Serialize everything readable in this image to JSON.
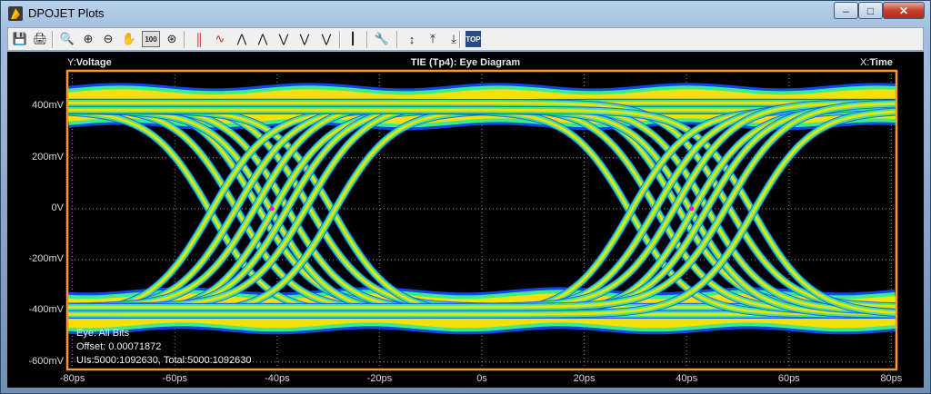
{
  "window": {
    "title": "DPOJET Plots"
  },
  "controls": {
    "minimize": "–",
    "maximize": "□",
    "close": "✕"
  },
  "toolbar": [
    {
      "name": "save-icon",
      "glyph": "💾"
    },
    {
      "name": "print-icon",
      "glyph": "🖨"
    },
    {
      "name": "zoom-in-icon",
      "glyph": "🔍"
    },
    {
      "name": "zoom-box-icon",
      "glyph": "⊕"
    },
    {
      "name": "zoom-out-icon",
      "glyph": "⊖"
    },
    {
      "name": "pan-hand-icon",
      "glyph": "✋"
    },
    {
      "name": "zoom-100-icon",
      "glyph": "100"
    },
    {
      "name": "zoom-disabled-icon",
      "glyph": "⊛"
    },
    {
      "name": "cursor-vertical-icon",
      "glyph": "║"
    },
    {
      "name": "cursor-waveform-icon",
      "glyph": "∿"
    },
    {
      "name": "reset-icon-1",
      "glyph": "⋀"
    },
    {
      "name": "reset-icon-2",
      "glyph": "⋀"
    },
    {
      "name": "mask-icon-1",
      "glyph": "⋁"
    },
    {
      "name": "mask-icon-2",
      "glyph": "⋁"
    },
    {
      "name": "mask-icon-3",
      "glyph": "⋁"
    },
    {
      "name": "histogram-icon",
      "glyph": "┃"
    },
    {
      "name": "wrench-icon",
      "glyph": "🔧"
    },
    {
      "name": "fit-vertical-icon",
      "glyph": "↕"
    },
    {
      "name": "align-top-icon",
      "glyph": "⤒"
    },
    {
      "name": "align-bottom-icon",
      "glyph": "⤓"
    },
    {
      "name": "top-icon",
      "glyph": "TOP"
    }
  ],
  "plot": {
    "y_axis_prefix": "Y:",
    "y_axis_name": "Voltage",
    "x_axis_prefix": "X:",
    "x_axis_name": "Time",
    "title": "TIE (Tp4): Eye Diagram",
    "y_ticks": [
      "400mV",
      "200mV",
      "0V",
      "-200mV",
      "-400mV",
      "-600mV"
    ],
    "x_ticks": [
      "-80ps",
      "-60ps",
      "-40ps",
      "-20ps",
      "0s",
      "20ps",
      "40ps",
      "60ps",
      "80ps"
    ],
    "legend": {
      "line1": "Eye: All Bits",
      "line2": "Offset: 0.00071872",
      "line3": "UIs:5000:1092630, Total:5000:1092630"
    },
    "colors": {
      "frame": "#ff9922",
      "grid": "#8a8a8a",
      "trace_hot": "#ff3000",
      "trace_mid": "#ffe000",
      "trace_cool": "#40ff80",
      "trace_edge": "#1050ff",
      "marker": "#ff00ff"
    }
  },
  "chart_data": {
    "type": "eye-diagram",
    "title": "TIE (Tp4): Eye Diagram",
    "xlabel": "Time",
    "ylabel": "Voltage",
    "x_ticks": [
      -80,
      -60,
      -40,
      -20,
      0,
      20,
      40,
      60,
      80
    ],
    "x_unit": "ps",
    "y_ticks": [
      400,
      200,
      0,
      -200,
      -400,
      -600
    ],
    "y_unit": "mV",
    "xlim": [
      -81,
      81
    ],
    "ylim": [
      -630,
      540
    ],
    "levels_mV": {
      "high": 400,
      "low": -400
    },
    "crossings_ps": [
      -41,
      41
    ],
    "crossing_voltage_mV": 0,
    "grid": true
  }
}
